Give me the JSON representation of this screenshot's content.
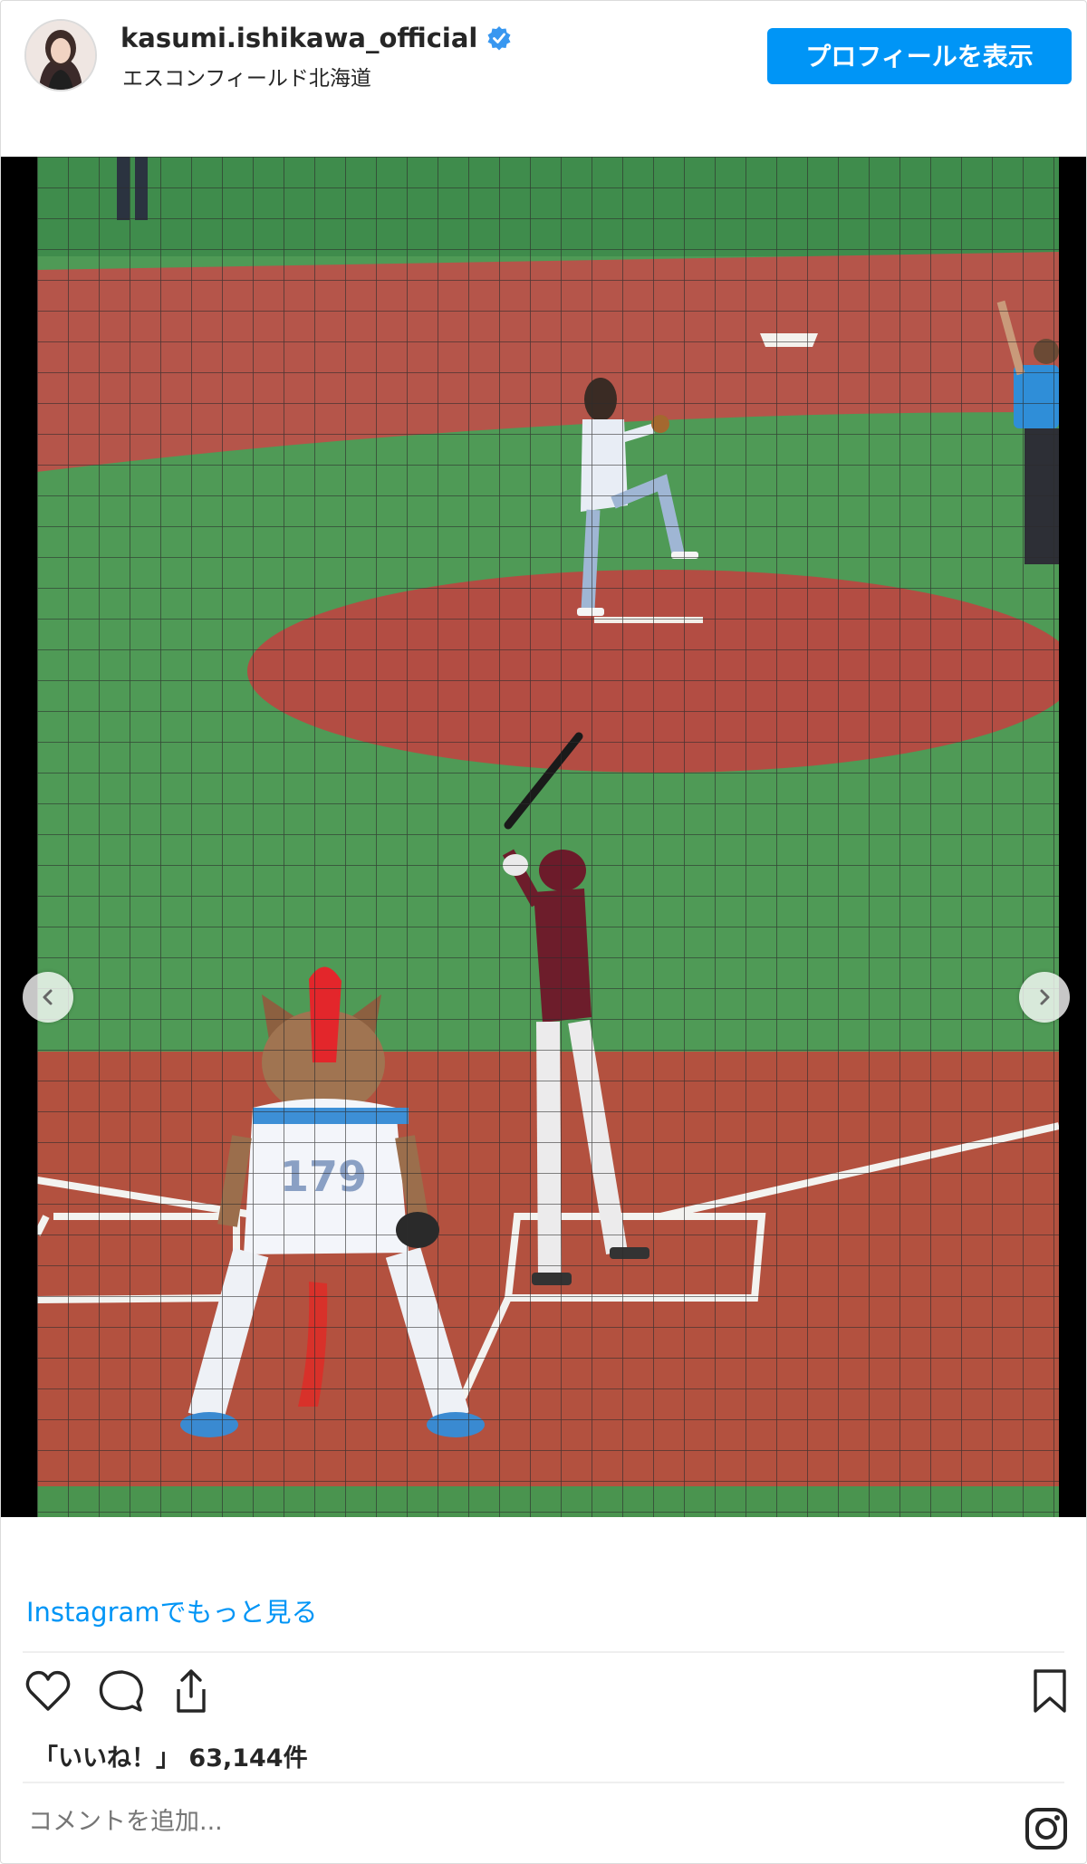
{
  "post": {
    "username": "kasumi.ishikawa_official",
    "location": "エスコンフィールド北海道",
    "profile_button": "プロフィールを表示",
    "more_link": "Instagramでもっと見る",
    "likes_label": "「いいね！」",
    "likes_count": "63,144件",
    "comment_placeholder": "コメントを追加...",
    "mascot_number": "179"
  },
  "icons": {
    "verified": "verified-badge-icon",
    "like": "heart-icon",
    "comment": "comment-bubble-icon",
    "share": "share-icon",
    "save": "bookmark-icon",
    "instagram": "instagram-logo-icon",
    "prev": "chevron-left-icon",
    "next": "chevron-right-icon"
  },
  "colors": {
    "accent": "#0095f6",
    "text": "#262626",
    "muted": "#8e8e8e"
  }
}
